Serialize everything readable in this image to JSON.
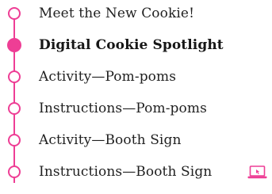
{
  "colors": {
    "accent": "#ee3e95",
    "text": "#1f1f1f"
  },
  "steps": [
    {
      "label": "Meet the New Cookie!",
      "state": "incomplete"
    },
    {
      "label": "Digital Cookie Spotlight",
      "state": "current"
    },
    {
      "label": "Activity—Pom-poms",
      "state": "incomplete"
    },
    {
      "label": "Instructions—Pom-poms",
      "state": "incomplete"
    },
    {
      "label": "Activity—Booth Sign",
      "state": "incomplete"
    },
    {
      "label": "Instructions—Booth Sign",
      "state": "incomplete",
      "icon": "laptop-icon"
    }
  ]
}
